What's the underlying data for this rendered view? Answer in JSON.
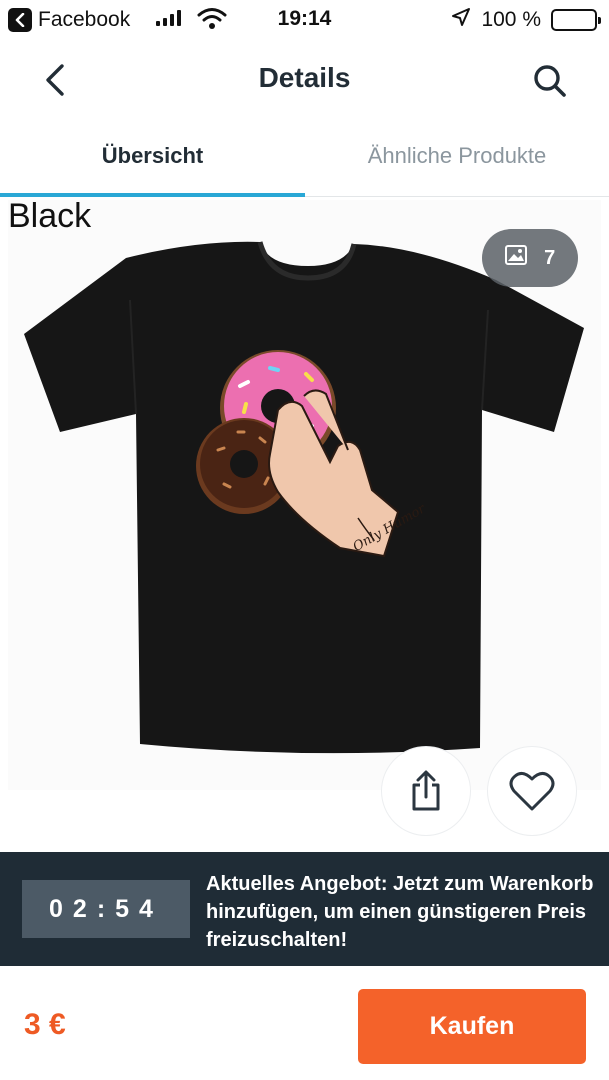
{
  "status_bar": {
    "back_app": "Facebook",
    "time": "19:14",
    "battery": "100 %"
  },
  "header": {
    "title": "Details"
  },
  "tabs": [
    {
      "label": "Übersicht",
      "active": true
    },
    {
      "label": "Ähnliche Produkte",
      "active": false
    }
  ],
  "product": {
    "variant": "Black",
    "image_count": "7",
    "shirt_color": "#161616",
    "print_text": "Only Humor"
  },
  "offer": {
    "timer": "02:54",
    "message": "Aktuelles Angebot: Jetzt zum Warenkorb hinzufügen, um einen günstigeren Preis freizuschalten!"
  },
  "purchase": {
    "price": "3 €",
    "buy_label": "Kaufen"
  },
  "colors": {
    "accent": "#f4622a",
    "tab_indicator": "#2aa8d6",
    "banner": "#1f2c36"
  }
}
